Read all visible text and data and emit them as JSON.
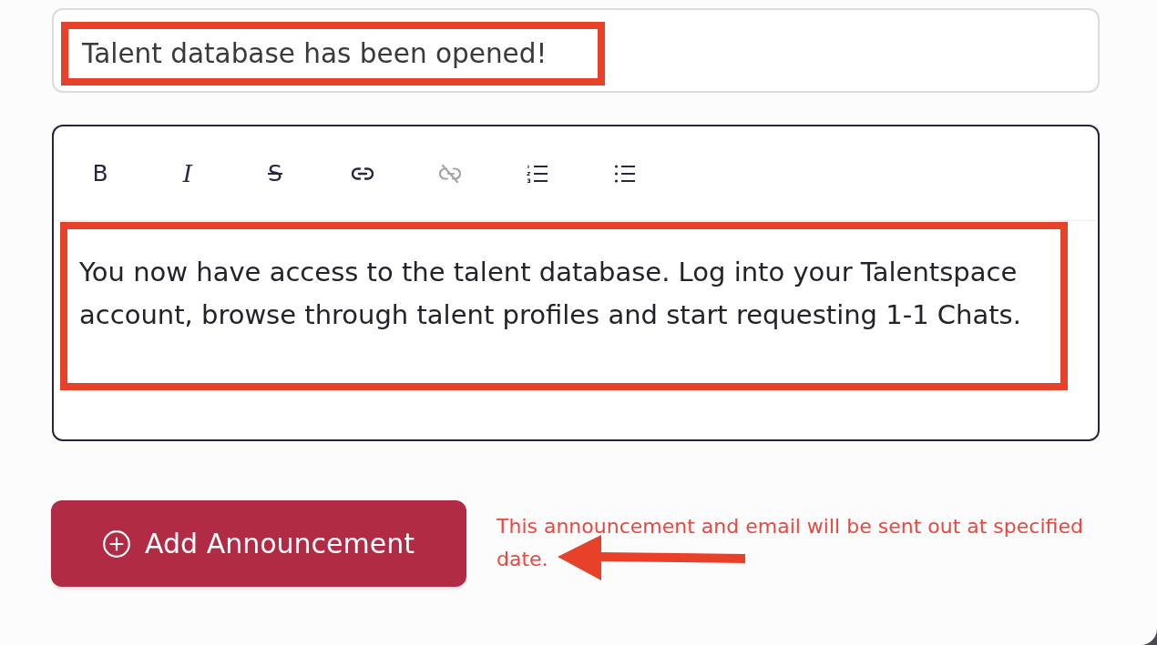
{
  "title_field": {
    "value": "Talent database has been opened!",
    "highlighted": true
  },
  "editor": {
    "toolbar": [
      {
        "kind": "bold",
        "glyph": "B",
        "disabled": false
      },
      {
        "kind": "italic",
        "glyph": "I",
        "disabled": false
      },
      {
        "kind": "strikethrough",
        "glyph": "S",
        "disabled": false
      },
      {
        "kind": "link",
        "disabled": false
      },
      {
        "kind": "unlink",
        "disabled": true
      },
      {
        "kind": "ordered-list",
        "disabled": false
      },
      {
        "kind": "bullet-list",
        "disabled": false
      }
    ],
    "body": {
      "text": "You now have access to the talent database. Log into your Talentspace account, browse through talent profiles and start requesting 1-1 Chats.",
      "highlighted": true
    }
  },
  "add_button": {
    "label": "Add Announcement"
  },
  "note": {
    "text": "This announcement and email will be sent out at specified date.",
    "arrow": true
  }
}
